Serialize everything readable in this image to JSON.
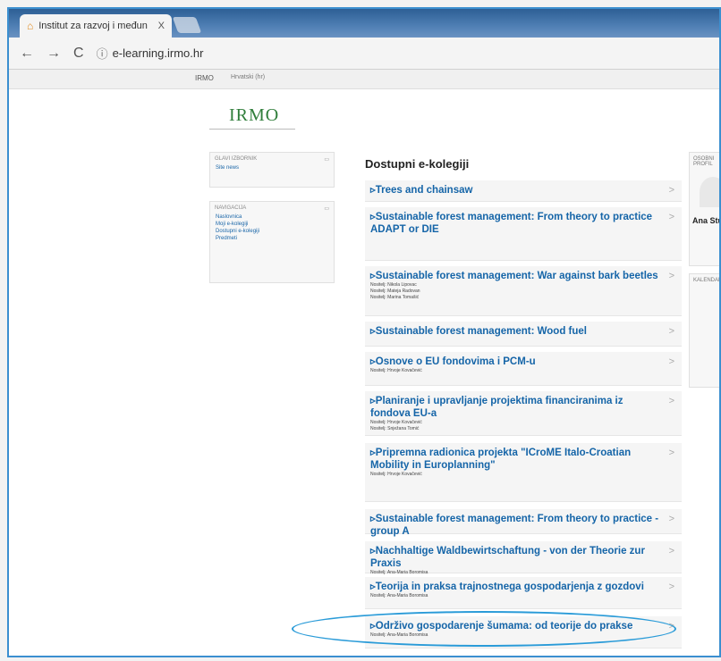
{
  "browser": {
    "tab_title": "Institut za razvoj i međun",
    "tab_close": "X",
    "url": "e-learning.irmo.hr"
  },
  "navbar": {
    "brand": "IRMO",
    "language": "Hrvatski (hr)"
  },
  "logo": "IRMO",
  "blocks": {
    "main_menu": {
      "title": "GLAVI IZBORNIK",
      "items": [
        "Site news"
      ]
    },
    "navigation": {
      "title": "NAVIGACIJA",
      "items": [
        "Naslovnica",
        "Moji e-kolegiji",
        "Dostupni e-kolegiji",
        "Predmeti"
      ]
    }
  },
  "main": {
    "heading": "Dostupni e-kolegiji",
    "courses": [
      {
        "title": "Trees and chainsaw",
        "teachers": []
      },
      {
        "title": "Sustainable forest management: From theory to practice ADAPT or DIE",
        "teachers": []
      },
      {
        "title": "Sustainable forest management: War against bark beetles",
        "teachers": [
          "Nositelj: Nikola Lipovac",
          "Nositelj: Mateja Radovan",
          "Nositelj: Marina Tomašić"
        ]
      },
      {
        "title": "Sustainable forest management: Wood fuel",
        "teachers": []
      },
      {
        "title": "Osnove o EU fondovima i PCM-u",
        "teachers": [
          "Nositelj: Hrvoje Kovačević"
        ]
      },
      {
        "title": "Planiranje i upravljanje projektima financiranima iz fondova EU-a",
        "teachers": [
          "Nositelj: Hrvoje Kovačević",
          "Nositelj: Snježana Tomić"
        ]
      },
      {
        "title": "Pripremna radionica projekta \"ICroME Italo-Croatian Mobility in Europlanning\"",
        "teachers": [
          "Nositelj: Hrvoje Kovačević"
        ]
      },
      {
        "title": "Sustainable forest management: From theory to practice - group A",
        "teachers": []
      },
      {
        "title": "Nachhaltige Waldbewirtschaftung - von der Theorie zur Praxis",
        "teachers": [
          "Nositelj: Ana-Maria Boromisa"
        ]
      },
      {
        "title": "Teorija in praksa trajnostnega gospodarjenja z gozdovi",
        "teachers": [
          "Nositelj: Ana-Maria Boromisa"
        ]
      },
      {
        "title": "Održivo gospodarenje šumama: od teorije do prakse",
        "teachers": [
          "Nositelj: Ana-Maria Boromisa"
        ]
      }
    ]
  },
  "right": {
    "profile_title": "OSOBNI PROFIL",
    "user_name": "Ana Stu",
    "calendar_title": "KALENDAR"
  },
  "colors": {
    "accent": "#1565a8",
    "highlight_ellipse": "#2a9bd8"
  }
}
